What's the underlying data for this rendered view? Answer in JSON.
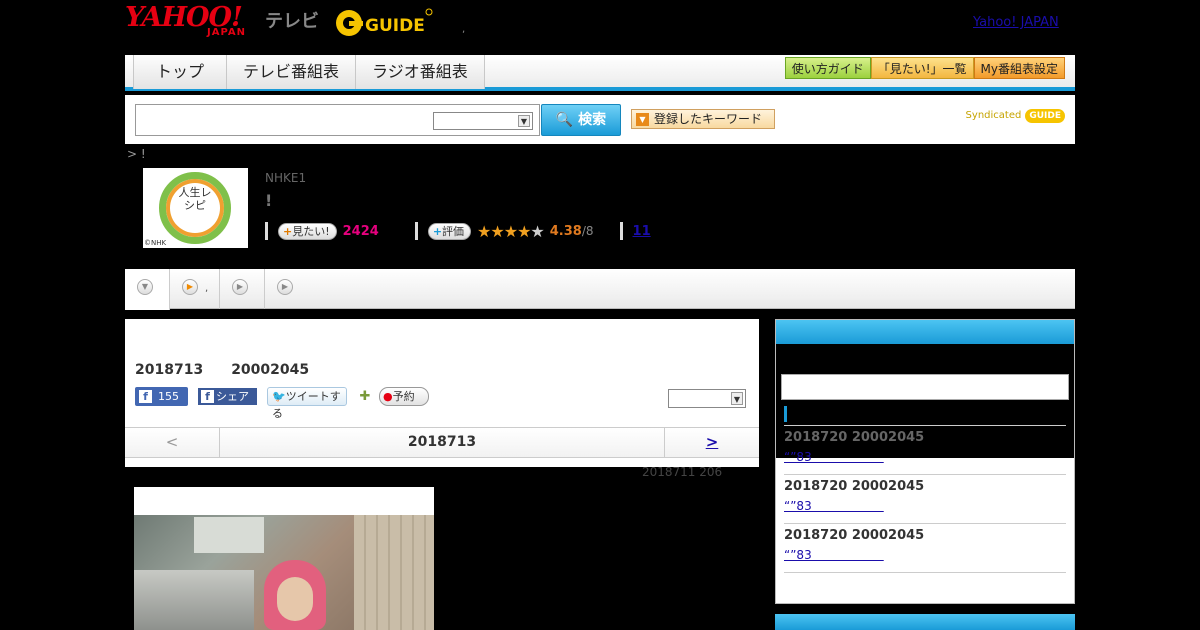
{
  "header": {
    "yahoo": "YAHOO!",
    "japan": "JAPAN",
    "tv": "テレビ",
    "gguide": "G GUIDE",
    "dot": ",",
    "link": "Yahoo! JAPAN"
  },
  "nav": {
    "tabs": [
      "トップ",
      "テレビ番組表",
      "ラジオ番組表"
    ],
    "buttons": [
      "使い方ガイド",
      "「見たい!」一覧",
      "My番組表設定"
    ]
  },
  "search": {
    "button": "検索",
    "keyword_button": "登録したキーワード",
    "syndicated": "Syndicated",
    "gguide": "GUIDE"
  },
  "breadcrumb": "> !",
  "program": {
    "thumb_text": "人生レシピ",
    "thumb_copyright": "©NHK",
    "channel": "NHKE1",
    "title": "!",
    "mitai_label": "見たい!",
    "mitai_count": "2424",
    "hyouka_label": "評価",
    "rating": "4.38",
    "rating_max": "/8",
    "review_link": "11",
    "stars_filled": 4
  },
  "subtabs": {
    "second_label": ","
  },
  "main": {
    "date_line": "2018713　　20002045",
    "fb_like_count": "155",
    "fb_share": "シェア",
    "tweet": "ツイートする",
    "reserve": "予約",
    "prev": "<",
    "current_date": "2018713",
    "next": ">",
    "updated": "2018711  206"
  },
  "sidebar": {
    "items": [
      {
        "date": "2018720  20002045",
        "link": "“”83　　　　　　"
      },
      {
        "date": "2018720  20002045",
        "link": "“”83　　　　　　"
      },
      {
        "date": "2018720  20002045",
        "link": "“”83　　　　　　"
      }
    ]
  },
  "colors": {
    "accent_blue": "#1a9bd7",
    "yahoo_red": "#e60012",
    "mitai_pink": "#e6007e",
    "rating_orange": "#e07a20"
  }
}
